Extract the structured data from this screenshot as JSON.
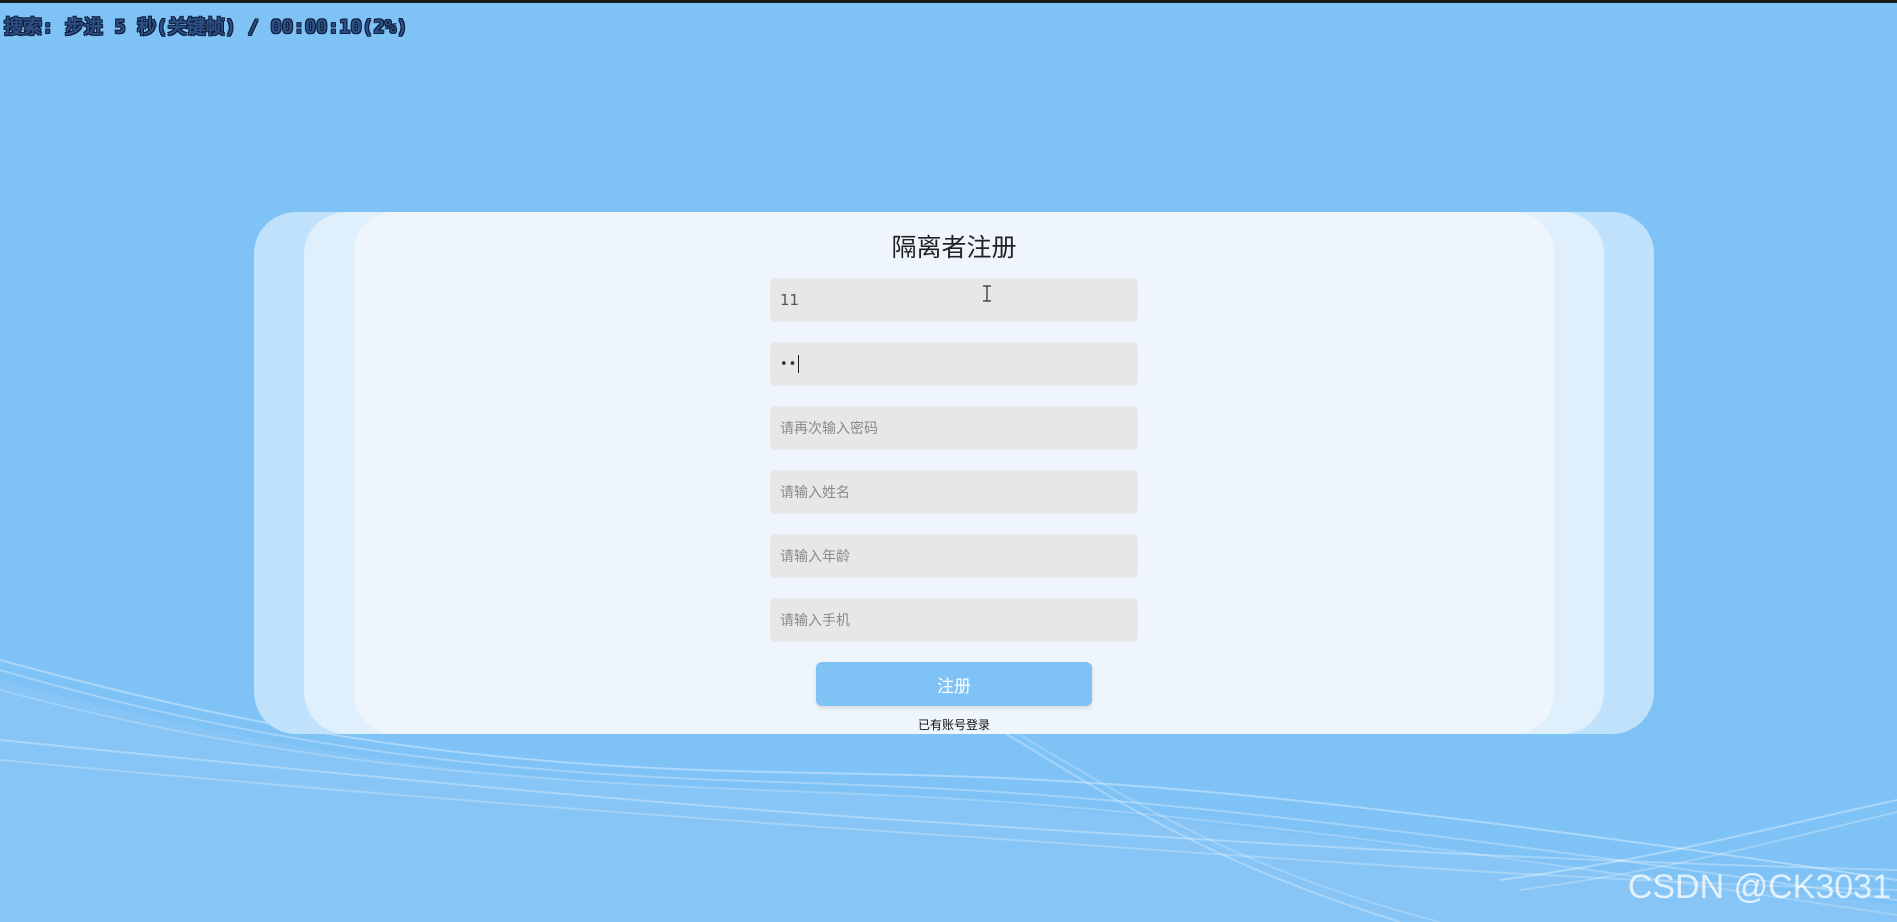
{
  "overlay": {
    "playback_status": "搜索: 步进 5 秒(关键帧) / 00:00:10(2%)"
  },
  "form": {
    "title": "隔离者注册",
    "fields": [
      {
        "value": "11",
        "placeholder": ""
      },
      {
        "value": "••",
        "placeholder": ""
      },
      {
        "value": "",
        "placeholder": "请再次输入密码"
      },
      {
        "value": "",
        "placeholder": "请输入姓名"
      },
      {
        "value": "",
        "placeholder": "请输入年龄"
      },
      {
        "value": "",
        "placeholder": "请输入手机"
      }
    ],
    "submit_label": "注册",
    "login_link": "已有账号登录"
  },
  "watermark": "CSDN @CK3031",
  "colors": {
    "background": "#7fc2f6",
    "card": "#eff5fc",
    "field": "#e7e7e7",
    "button": "#7fc2f6"
  }
}
